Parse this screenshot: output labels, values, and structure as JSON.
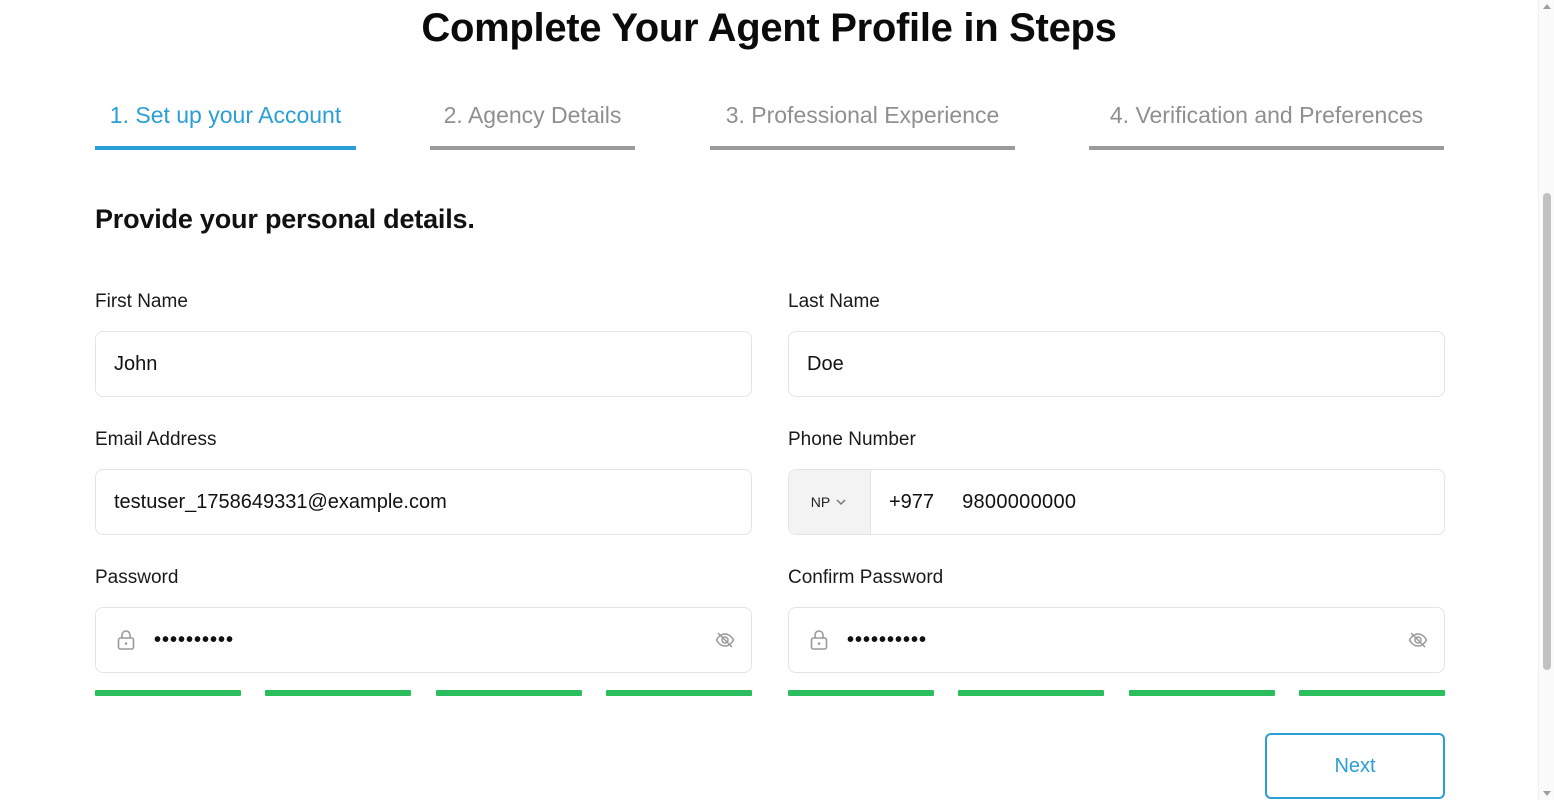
{
  "page": {
    "title": "Complete Your Agent Profile in Steps"
  },
  "steps": [
    {
      "label": "1. Set up your Account",
      "active": true
    },
    {
      "label": "2. Agency Details",
      "active": false
    },
    {
      "label": "3. Professional Experience",
      "active": false
    },
    {
      "label": "4. Verification and Preferences",
      "active": false
    }
  ],
  "form": {
    "heading": "Provide your personal details.",
    "first_name": {
      "label": "First Name",
      "value": "John"
    },
    "last_name": {
      "label": "Last Name",
      "value": "Doe"
    },
    "email": {
      "label": "Email Address",
      "value": "testuser_1758649331@example.com"
    },
    "phone": {
      "label": "Phone Number",
      "country": "NP",
      "dial_code": "+977",
      "value": "9800000000"
    },
    "password": {
      "label": "Password",
      "masked_value": "••••••••••",
      "strength_bars_filled": 4,
      "strength_bars_total": 4
    },
    "confirm_password": {
      "label": "Confirm Password",
      "masked_value": "••••••••••",
      "strength_bars_filled": 4,
      "strength_bars_total": 4
    }
  },
  "actions": {
    "next_label": "Next"
  },
  "colors": {
    "accent": "#2a9fd6",
    "inactive_step": "#9a9a9a",
    "strength_good": "#2bbd5e"
  },
  "icons": {
    "lock": "lock-icon",
    "eye_hidden": "eye-slash-icon",
    "chevron": "chevron-down-icon"
  }
}
